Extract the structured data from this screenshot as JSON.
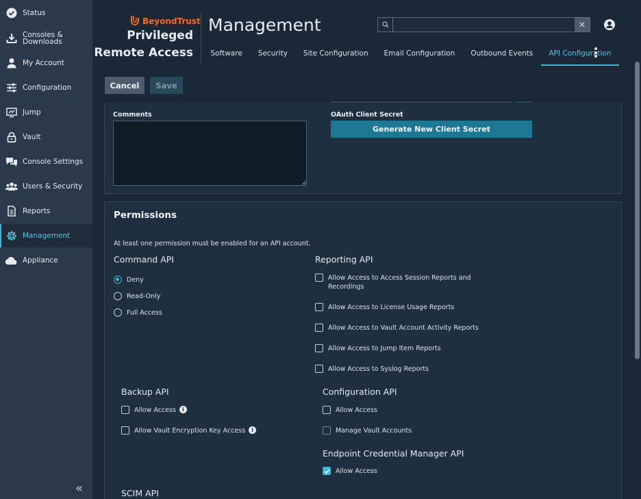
{
  "sidebar": {
    "items": [
      {
        "label": "Status",
        "icon": "check-circle-icon"
      },
      {
        "label": "Consoles &\nDownloads",
        "icon": "download-icon"
      },
      {
        "label": "My Account",
        "icon": "person-icon"
      },
      {
        "label": "Configuration",
        "icon": "sliders-icon"
      },
      {
        "label": "Jump",
        "icon": "jump-icon"
      },
      {
        "label": "Vault",
        "icon": "lock-icon"
      },
      {
        "label": "Console Settings",
        "icon": "chat-bubbles-icon"
      },
      {
        "label": "Users & Security",
        "icon": "users-icon"
      },
      {
        "label": "Reports",
        "icon": "report-icon"
      },
      {
        "label": "Management",
        "icon": "gear-icon"
      },
      {
        "label": "Appliance",
        "icon": "cloud-icon"
      }
    ],
    "active_index": 9,
    "collapse_label": "«"
  },
  "header": {
    "brand": "BeyondTrust",
    "product_line1": "Privileged",
    "product_line2": "Remote Access",
    "title": "Management",
    "search_placeholder": "",
    "clear_label": "×",
    "tabs": [
      {
        "label": "Software"
      },
      {
        "label": "Security"
      },
      {
        "label": "Site Configuration"
      },
      {
        "label": "Email Configuration"
      },
      {
        "label": "Outbound Events"
      },
      {
        "label": "API Configuration"
      }
    ],
    "active_tab": "API Configuration"
  },
  "actions": {
    "cancel_label": "Cancel",
    "save_label": "Save"
  },
  "form": {
    "comments_label": "Comments",
    "comments_value": "",
    "secret_label": "OAuth Client Secret",
    "generate_label": "Generate New Client Secret"
  },
  "permissions": {
    "title": "Permissions",
    "note": "At least one permission must be enabled for an API account.",
    "command_api": {
      "title": "Command API",
      "options": [
        "Deny",
        "Read-Only",
        "Full Access"
      ],
      "selected": "Deny"
    },
    "reporting_api": {
      "title": "Reporting API",
      "items": [
        {
          "label": "Allow Access to Access Session Reports and\nRecordings",
          "checked": false
        },
        {
          "label": "Allow Access to License Usage Reports",
          "checked": false
        },
        {
          "label": "Allow Access to Vault Account Activity Reports",
          "checked": false
        },
        {
          "label": "Allow Access to Jump Item Reports",
          "checked": false
        },
        {
          "label": "Allow Access to Syslog Reports",
          "checked": false
        }
      ]
    },
    "backup_api": {
      "title": "Backup API",
      "items": [
        {
          "label": "Allow Access",
          "checked": false
        },
        {
          "label": "Allow Vault Encryption Key Access",
          "checked": false
        }
      ]
    },
    "configuration_api": {
      "title": "Configuration API",
      "items": [
        {
          "label": "Allow Access",
          "checked": false
        },
        {
          "label": "Manage Vault Accounts",
          "checked": false
        }
      ]
    },
    "ecm_api": {
      "title": "Endpoint Credential Manager API",
      "items": [
        {
          "label": "Allow Access",
          "checked": true
        }
      ]
    },
    "scim_api": {
      "title": "SCIM API"
    }
  },
  "colors": {
    "accent": "#42b4d6",
    "brand_orange": "#f26b21",
    "sidebar_bg": "#2b3a4a",
    "page_bg": "#1a2838",
    "panel_bg": "#1e2f40",
    "generate_button": "#1e7893"
  }
}
